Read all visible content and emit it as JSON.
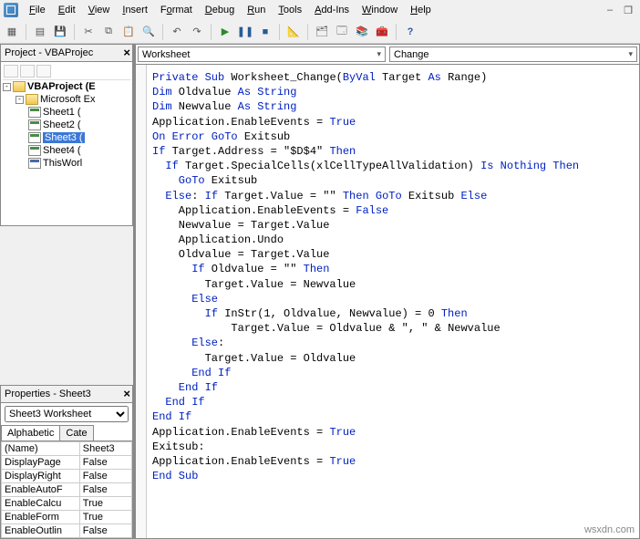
{
  "menu": {
    "file": "File",
    "edit": "Edit",
    "view": "View",
    "insert": "Insert",
    "format": "Format",
    "debug": "Debug",
    "run": "Run",
    "tools": "Tools",
    "addins": "Add-Ins",
    "window": "Window",
    "help": "Help"
  },
  "project_panel": {
    "title": "Project - VBAProjec"
  },
  "tree": {
    "root": "VBAProject (E",
    "folder": "Microsoft Ex",
    "items": [
      "Sheet1 (",
      "Sheet2 (",
      "Sheet3 (",
      "Sheet4 (",
      "ThisWorl"
    ],
    "selected_index": 2
  },
  "properties_panel": {
    "title": "Properties - Sheet3"
  },
  "prop_combo": "Sheet3 Worksheet",
  "prop_tabs": {
    "a": "Alphabetic",
    "b": "Cate"
  },
  "props": [
    {
      "name": "(Name)",
      "value": "Sheet3"
    },
    {
      "name": "DisplayPage",
      "value": "False"
    },
    {
      "name": "DisplayRight",
      "value": "False"
    },
    {
      "name": "EnableAutoF",
      "value": "False"
    },
    {
      "name": "EnableCalcu",
      "value": "True"
    },
    {
      "name": "EnableForm",
      "value": "True"
    },
    {
      "name": "EnableOutlin",
      "value": "False"
    }
  ],
  "code_dd": {
    "left": "Worksheet",
    "right": "Change"
  },
  "code": {
    "l01a": "Private Sub",
    "l01b": " Worksheet_Change(",
    "l01c": "ByVal",
    "l01d": " Target ",
    "l01e": "As",
    "l01f": " Range)",
    "l02a": "Dim",
    "l02b": " Oldvalue ",
    "l02c": "As String",
    "l03a": "Dim",
    "l03b": " Newvalue ",
    "l03c": "As String",
    "l04a": "Application.EnableEvents = ",
    "l04b": "True",
    "l05a": "On Error GoTo",
    "l05b": " Exitsub",
    "l06a": "If",
    "l06b": " Target.Address = ",
    "l06s": "\"$D$4\"",
    "l06c": " Then",
    "l07a": "  If",
    "l07b": " Target.SpecialCells(xlCellTypeAllValidation) ",
    "l07c": "Is Nothing Then",
    "l08a": "    GoTo",
    "l08b": " Exitsub",
    "l09a": "  Else",
    "l09b": ": ",
    "l09c": "If",
    "l09d": " Target.Value = ",
    "l09s": "\"\"",
    "l09e": " Then GoTo",
    "l09f": " Exitsub ",
    "l09g": "Else",
    "l10a": "    Application.EnableEvents = ",
    "l10b": "False",
    "l11": "    Newvalue = Target.Value",
    "l12": "    Application.Undo",
    "l13": "    Oldvalue = Target.Value",
    "l14a": "      If",
    "l14b": " Oldvalue = ",
    "l14s": "\"\"",
    "l14c": " Then",
    "l15": "        Target.Value = Newvalue",
    "l16a": "      Else",
    "l17a": "        If",
    "l17b": " InStr(1, Oldvalue, Newvalue) = 0 ",
    "l17c": "Then",
    "l18a": "            Target.Value = Oldvalue & ",
    "l18s": "\", \"",
    "l18b": " & Newvalue",
    "l19a": "      Else",
    "l19b": ":",
    "l20": "        Target.Value = Oldvalue",
    "l21a": "      End If",
    "l22a": "    End If",
    "l23a": "  End If",
    "l24a": "End If",
    "l25a": "Application.EnableEvents = ",
    "l25b": "True",
    "l26": "Exitsub:",
    "l27a": "Application.EnableEvents = ",
    "l27b": "True",
    "l28a": "End Sub"
  },
  "watermark": "wsxdn.com"
}
